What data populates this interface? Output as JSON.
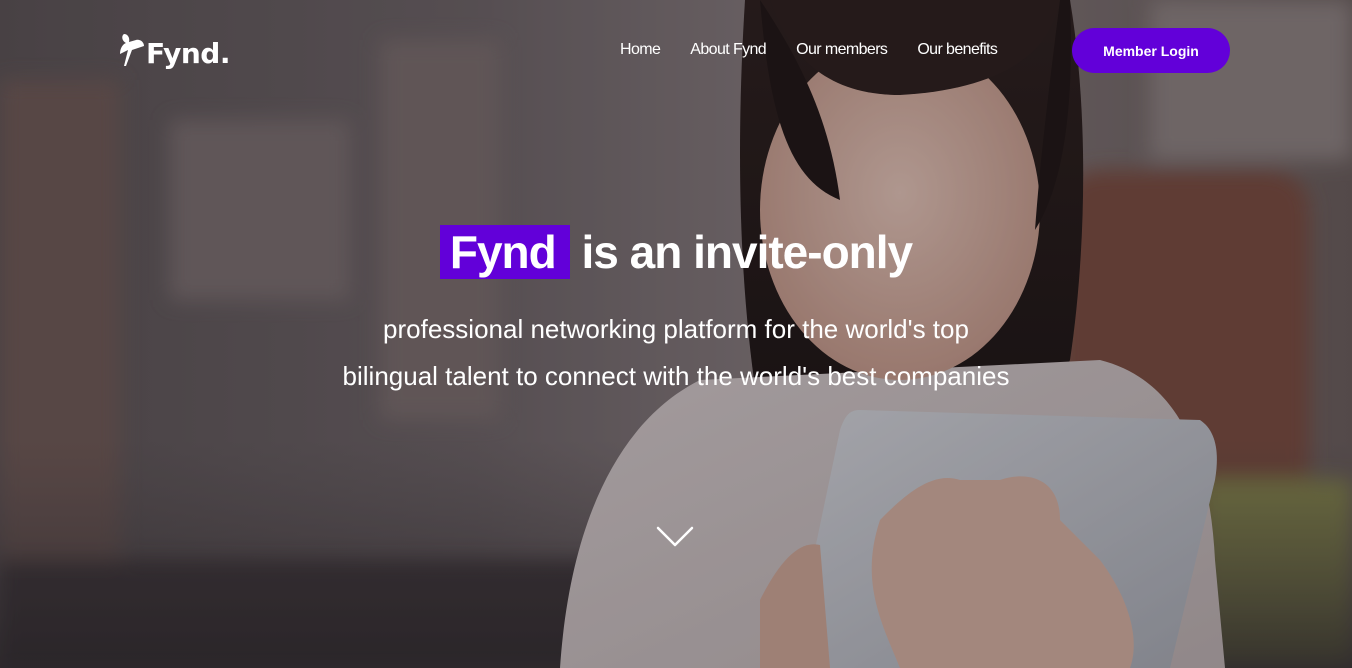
{
  "brand": {
    "logo_text": "Fynd."
  },
  "nav": {
    "items": [
      {
        "label": "Home"
      },
      {
        "label": "About Fynd"
      },
      {
        "label": "Our members"
      },
      {
        "label": "Our benefits"
      }
    ],
    "login_label": "Member Login"
  },
  "hero": {
    "highlight": "Fynd",
    "headline_rest": "is an invite-only",
    "subtext": "professional networking platform for the world's top bilingual talent to connect with the world's best companies",
    "scroll_icon": "chevron-down-icon"
  },
  "colors": {
    "accent": "#6200d9",
    "text": "#ffffff"
  }
}
